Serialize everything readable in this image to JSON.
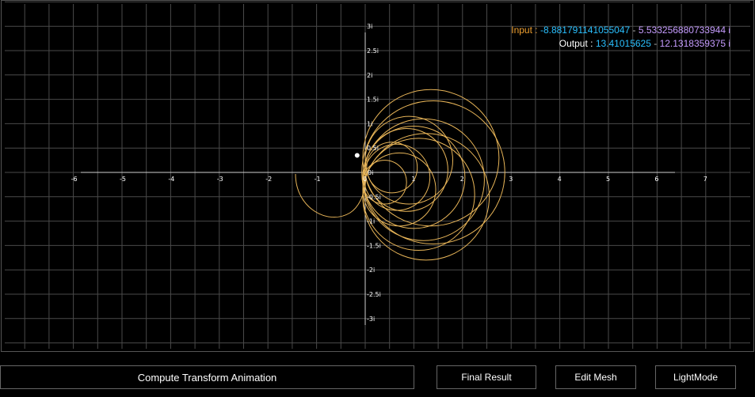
{
  "readout": {
    "input_label": "Input :",
    "input_real": "-8.881791141055047",
    "input_sep": "-",
    "input_imag": "5.533256880733944 i",
    "output_label": "Output :",
    "output_real": "13.41015625",
    "output_sep": "-",
    "output_imag": "12.1318359375 i"
  },
  "plot": {
    "x_ticks": [
      "-6",
      "-5",
      "-4",
      "-3",
      "-2",
      "-1",
      "0",
      "1",
      "2",
      "3",
      "4",
      "5",
      "6",
      "7"
    ],
    "y_ticks": [
      "3i",
      "2.5i",
      "2i",
      "1.5i",
      "1i",
      "0.5i",
      "0i",
      "-0.5i",
      "-1i",
      "-1.5i",
      "-2i",
      "-2.5i",
      "-3i"
    ],
    "x_range": [
      -6,
      7
    ],
    "y_range": [
      -3,
      3
    ],
    "grid": true,
    "curve_color": "#e8b558",
    "point": {
      "x": -0.15,
      "y": 0.35
    }
  },
  "buttons": {
    "compute": "Compute Transform Animation",
    "final": "Final Result",
    "edit": "Edit Mesh",
    "light": "LightMode"
  }
}
